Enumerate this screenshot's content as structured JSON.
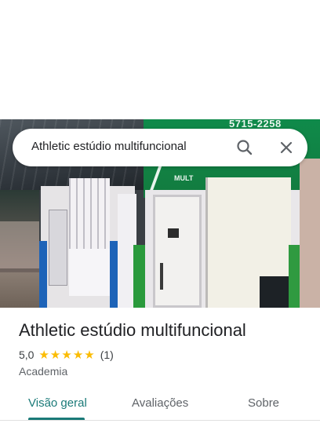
{
  "search": {
    "query": "Athletic estúdio multifuncional"
  },
  "photo": {
    "sign_text": "5715-2258",
    "sign_word": "MULT"
  },
  "place": {
    "name": "Athletic estúdio multifuncional",
    "rating": "5,0",
    "stars": 5,
    "review_count": "(1)",
    "category": "Academia"
  },
  "tabs": [
    {
      "label": "Visão geral",
      "active": true
    },
    {
      "label": "Avaliações",
      "active": false
    },
    {
      "label": "Sobre",
      "active": false
    }
  ],
  "colors": {
    "accent": "#1a7a78",
    "star": "#fbbc04"
  }
}
